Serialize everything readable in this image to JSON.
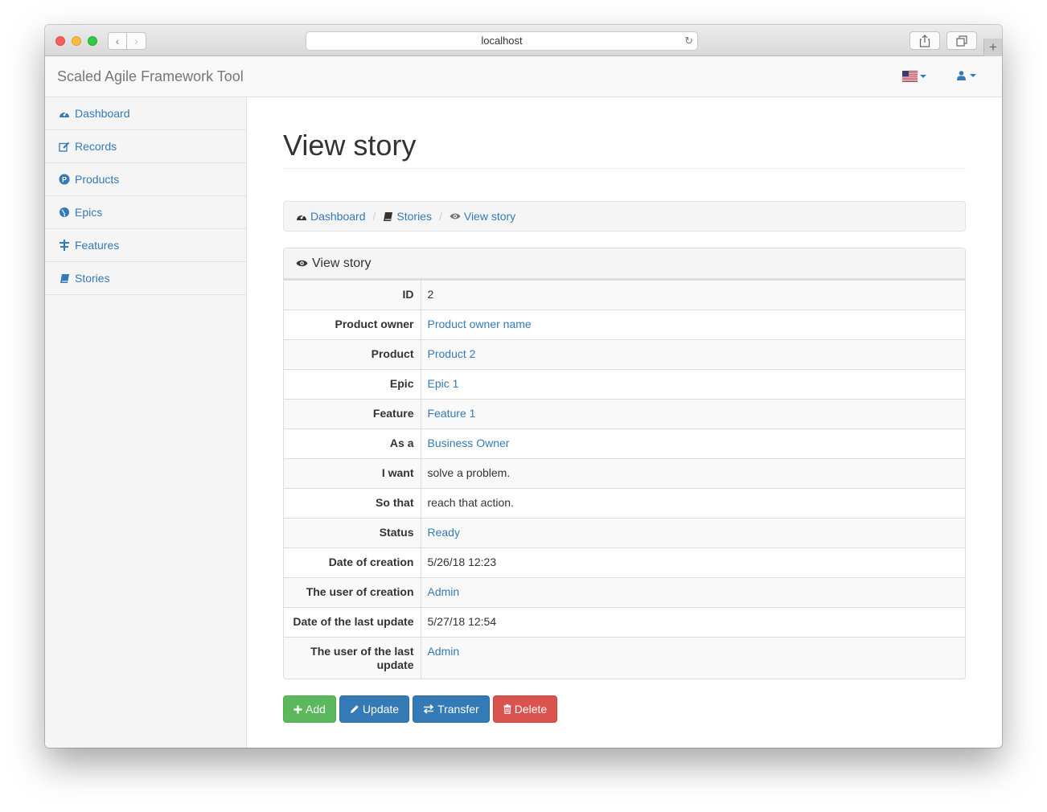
{
  "browser": {
    "url": "localhost"
  },
  "navbar": {
    "brand": "Scaled Agile Framework Tool"
  },
  "sidebar": {
    "items": [
      {
        "label": "Dashboard",
        "icon": "dashboard-icon"
      },
      {
        "label": "Records",
        "icon": "edit-icon"
      },
      {
        "label": "Products",
        "icon": "product-icon"
      },
      {
        "label": "Epics",
        "icon": "globe-icon"
      },
      {
        "label": "Features",
        "icon": "features-icon"
      },
      {
        "label": "Stories",
        "icon": "book-icon"
      }
    ]
  },
  "page": {
    "title": "View story"
  },
  "breadcrumb": {
    "dashboard": "Dashboard",
    "stories": "Stories",
    "current": "View story"
  },
  "panel": {
    "title": "View story"
  },
  "details": {
    "id_label": "ID",
    "id_value": "2",
    "product_owner_label": "Product owner",
    "product_owner_value": "Product owner name",
    "product_label": "Product",
    "product_value": "Product 2",
    "epic_label": "Epic",
    "epic_value": "Epic 1",
    "feature_label": "Feature",
    "feature_value": "Feature 1",
    "as_a_label": "As a",
    "as_a_value": "Business Owner",
    "i_want_label": "I want",
    "i_want_value": "solve a problem.",
    "so_that_label": "So that",
    "so_that_value": "reach that action.",
    "status_label": "Status",
    "status_value": "Ready",
    "created_label": "Date of creation",
    "created_value": "5/26/18 12:23",
    "created_by_label": "The user of creation",
    "created_by_value": "Admin",
    "updated_label": "Date of the last update",
    "updated_value": "5/27/18 12:54",
    "updated_by_label": "The user of the last update",
    "updated_by_value": "Admin"
  },
  "actions": {
    "add": "Add",
    "update": "Update",
    "transfer": "Transfer",
    "delete": "Delete"
  },
  "colors": {
    "link": "#337ab7",
    "success": "#5cb85c",
    "primary": "#337ab7",
    "danger": "#d9534f"
  }
}
